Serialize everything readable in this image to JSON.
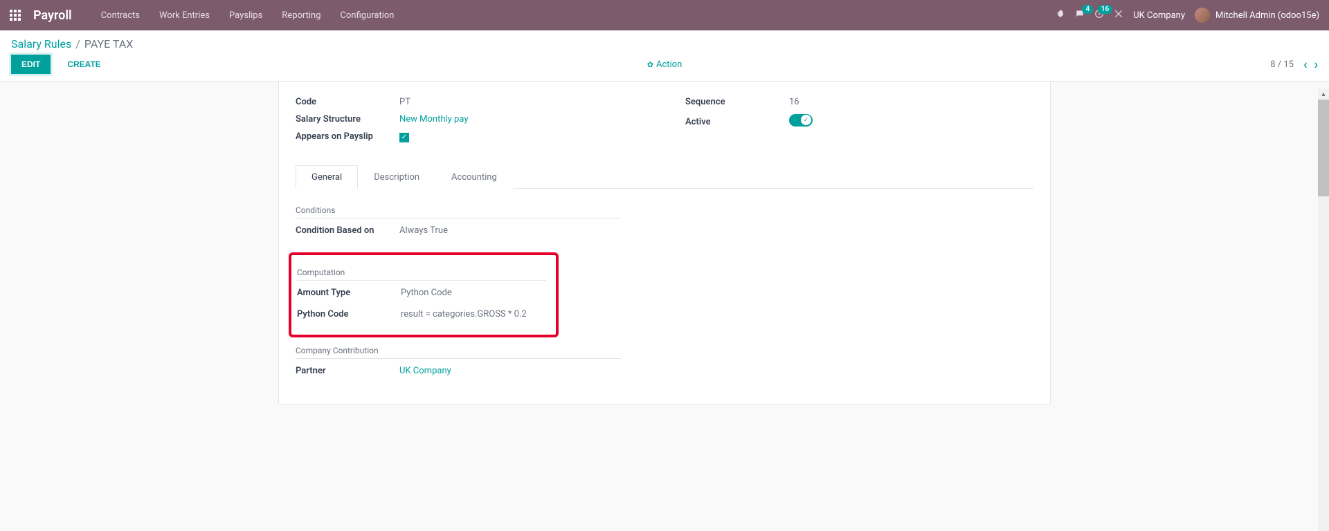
{
  "navbar": {
    "brand": "Payroll",
    "menu": [
      "Contracts",
      "Work Entries",
      "Payslips",
      "Reporting",
      "Configuration"
    ],
    "messages_badge": "4",
    "activities_badge": "16",
    "company": "UK Company",
    "user": "Mitchell Admin (odoo15e)"
  },
  "breadcrumb": {
    "parent": "Salary Rules",
    "current": "PAYE TAX"
  },
  "toolbar": {
    "edit": "EDIT",
    "create": "CREATE",
    "action": "Action",
    "pager": "8 / 15"
  },
  "form": {
    "code_label": "Code",
    "code_value": "PT",
    "salary_structure_label": "Salary Structure",
    "salary_structure_value": "New Monthly pay",
    "appears_label": "Appears on Payslip",
    "sequence_label": "Sequence",
    "sequence_value": "16",
    "active_label": "Active"
  },
  "tabs": [
    "General",
    "Description",
    "Accounting"
  ],
  "sections": {
    "conditions_title": "Conditions",
    "condition_based_label": "Condition Based on",
    "condition_based_value": "Always True",
    "computation_title": "Computation",
    "amount_type_label": "Amount Type",
    "amount_type_value": "Python Code",
    "python_code_label": "Python Code",
    "python_code_value": "result = categories.GROSS * 0.2",
    "company_contribution_title": "Company Contribution",
    "partner_label": "Partner",
    "partner_value": "UK Company"
  }
}
